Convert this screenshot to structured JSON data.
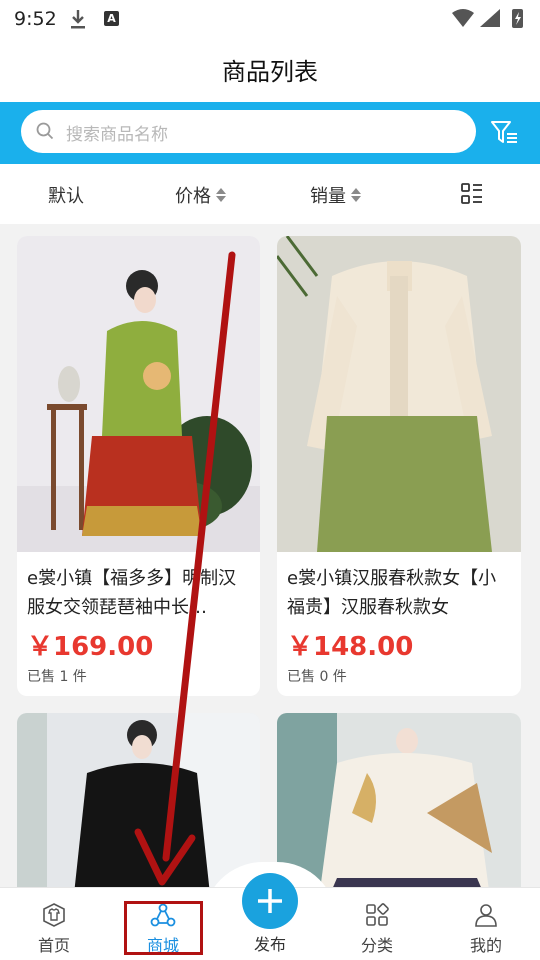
{
  "status_bar": {
    "time": "9:52"
  },
  "page_title": "商品列表",
  "search": {
    "placeholder": "搜索商品名称"
  },
  "sort_bar": {
    "default_label": "默认",
    "price_label": "价格",
    "sales_label": "销量"
  },
  "products": [
    {
      "name": "e裳小镇【福多多】明制汉服女交领琵琶袖中长…",
      "price": "￥169.00",
      "sold": "已售 1 件"
    },
    {
      "name": "e裳小镇汉服春秋款女【小福贵】汉服春秋款女",
      "price": "￥148.00",
      "sold": "已售 0 件"
    }
  ],
  "bottom_nav": {
    "home": "首页",
    "mall": "商城",
    "publish": "发布",
    "category": "分类",
    "mine": "我的"
  },
  "colors": {
    "accent_blue": "#1ab0ec",
    "price_red": "#e8382f",
    "annotation_red": "#b01212"
  },
  "icons": [
    "download-icon",
    "a-notification-icon",
    "wifi-icon",
    "signal-icon",
    "battery-icon",
    "search-icon",
    "filter-icon",
    "grid-list-icon",
    "home-shirt-icon",
    "mall-icon",
    "plus-icon",
    "category-icon",
    "user-icon"
  ]
}
